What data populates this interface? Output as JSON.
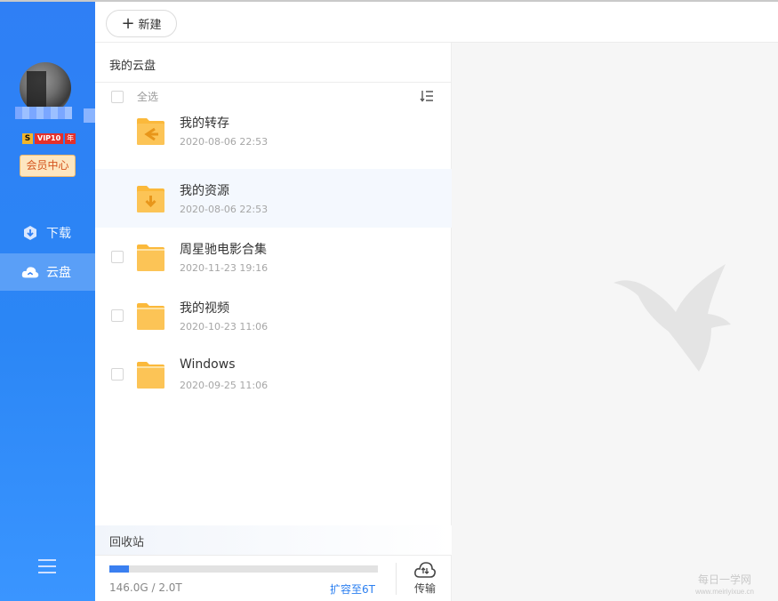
{
  "toolbar": {
    "new_label": "新建"
  },
  "sidebar": {
    "vip_level": "VIP10",
    "vip_year": "年",
    "member_center": "会员中心",
    "nav": [
      {
        "label": "下载",
        "icon": "download-icon"
      },
      {
        "label": "云盘",
        "icon": "cloud-icon",
        "active": true
      }
    ]
  },
  "panel": {
    "title": "我的云盘",
    "select_all": "全选",
    "files": [
      {
        "name": "我的转存",
        "date": "2020-08-06 22:53",
        "icon": "folder-transfer-icon"
      },
      {
        "name": "我的资源",
        "date": "2020-08-06 22:53",
        "icon": "folder-download-icon",
        "highlighted": true
      },
      {
        "name": "周星驰电影合集",
        "date": "2020-11-23 19:16",
        "icon": "folder-icon"
      },
      {
        "name": "我的视频",
        "date": "2020-10-23 11:06",
        "icon": "folder-icon"
      },
      {
        "name": "Windows",
        "date": "2020-09-25 11:06",
        "icon": "folder-icon"
      }
    ],
    "recycle_bin": "回收站",
    "storage": {
      "used_label": "146.0G / 2.0T",
      "used_fraction": 0.073,
      "expand_label": "扩容至6T"
    },
    "transfer_label": "传输"
  },
  "colors": {
    "sidebar": "#2f7ff5",
    "accent": "#2b7ff0",
    "folder": "#fbb93b",
    "member_text": "#d4531c"
  },
  "watermark": {
    "text": "每日一学网",
    "url_text": "www.meiriyixue.cn"
  }
}
